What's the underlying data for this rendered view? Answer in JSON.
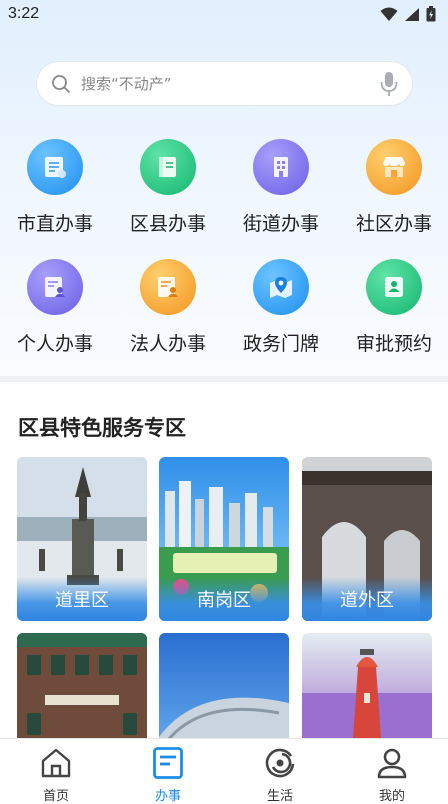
{
  "status_bar": {
    "time": "3:22"
  },
  "search": {
    "placeholder": "搜索“不动产”"
  },
  "services": [
    {
      "label": "市直办事",
      "icon": "document-list-icon",
      "color": "#2a9cf2"
    },
    {
      "label": "区县办事",
      "icon": "book-icon",
      "color": "#1ec57e"
    },
    {
      "label": "街道办事",
      "icon": "building-icon",
      "color": "#7b72ef"
    },
    {
      "label": "社区办事",
      "icon": "storefront-icon",
      "color": "#f7a43a"
    },
    {
      "label": "个人办事",
      "icon": "person-card-icon",
      "color": "#7b72ef"
    },
    {
      "label": "法人办事",
      "icon": "corporate-document-icon",
      "color": "#f7a43a"
    },
    {
      "label": "政务门牌",
      "icon": "map-pin-icon",
      "color": "#2a9cf2"
    },
    {
      "label": "审批预约",
      "icon": "appointment-card-icon",
      "color": "#1ec57e"
    }
  ],
  "district_section": {
    "title": "区县特色服务专区",
    "cards": [
      {
        "label": "道里区"
      },
      {
        "label": "南岗区"
      },
      {
        "label": "道外区"
      },
      {
        "label": ""
      },
      {
        "label": ""
      },
      {
        "label": ""
      }
    ]
  },
  "tab_bar": {
    "tabs": [
      {
        "label": "首页",
        "icon": "home-icon"
      },
      {
        "label": "办事",
        "icon": "document-icon",
        "active": true
      },
      {
        "label": "生活",
        "icon": "refresh-circle-icon"
      },
      {
        "label": "我的",
        "icon": "user-icon"
      }
    ],
    "active_color": "#1a8de6"
  }
}
